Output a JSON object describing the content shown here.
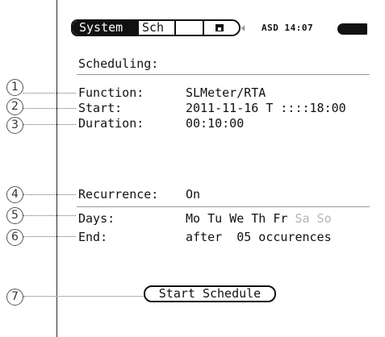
{
  "tabs": {
    "system": "System",
    "sch": "Sch"
  },
  "status": {
    "text": "ASD 14:07"
  },
  "icons": {
    "save": "floppy-disk-icon",
    "speaker": "speaker-icon",
    "battery": "battery-icon"
  },
  "scheduling": {
    "title": "Scheduling:",
    "function": {
      "label": "Function:",
      "value": "SLMeter/RTA"
    },
    "start": {
      "label": "Start:",
      "value": "2011-11-16 T ::::18:00"
    },
    "duration": {
      "label": "Duration:",
      "value": "00:10:00"
    },
    "recurrence": {
      "label": "Recurrence:",
      "value": "On"
    },
    "days": {
      "label": "Days:",
      "active": "Mo Tu We Th Fr",
      "inactive": "Sa So"
    },
    "end": {
      "label": "End:",
      "value": "after  05 occurences"
    }
  },
  "button": {
    "label": "Start Schedule"
  },
  "callouts": [
    "1",
    "2",
    "3",
    "4",
    "5",
    "6",
    "7"
  ]
}
